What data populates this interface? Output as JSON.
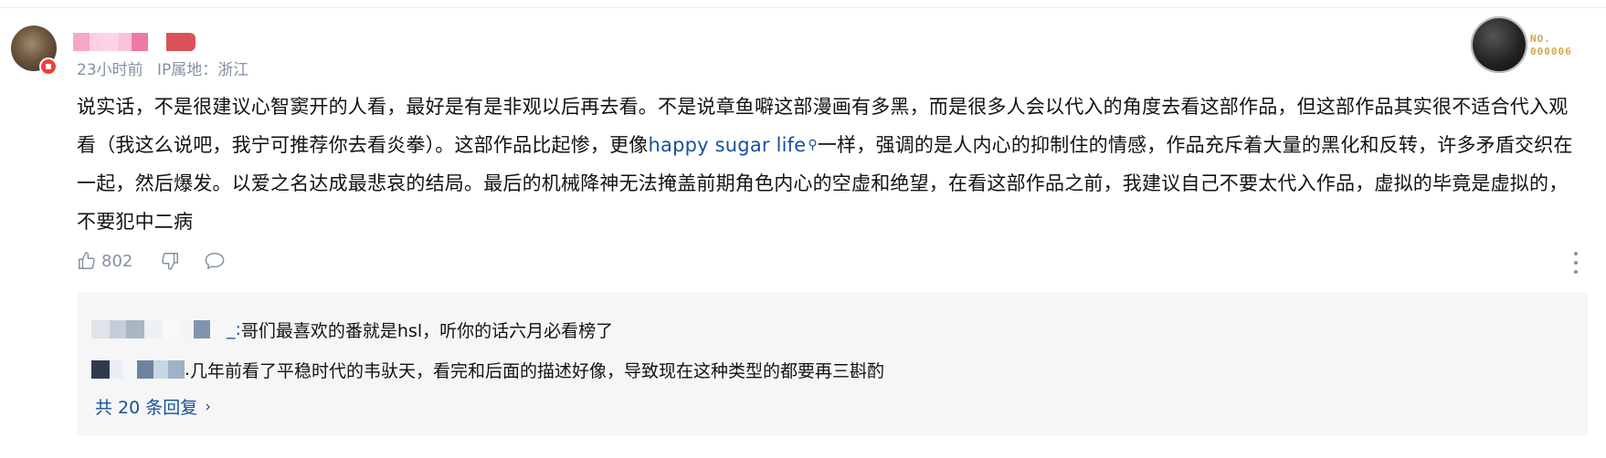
{
  "comment": {
    "meta": {
      "time": "23小时前",
      "ip_location": "IP属地：浙江"
    },
    "medal": {
      "label_line1": "NO.",
      "label_line2": "000006"
    },
    "content": {
      "text_before_link": "说实话，不是很建议心智窦开的人看，最好是有是非观以后再去看。不是说章鱼噼这部漫画有多黑，而是很多人会以代入的角度去看这部作品，但这部作品其实很不适合代入观看（我这么说吧，我宁可推荐你去看炎拳）。这部作品比起惨，更像",
      "link_text": "happy sugar life",
      "text_after_link": "一样，强调的是人内心的抑制住的情感，作品充斥着大量的黑化和反转，许多矛盾交织在一起，然后爆发。以爱之名达成最悲哀的结局。最后的机械降神无法掩盖前期角色内心的空虚和绝望，在看这部作品之前，我建议自己不要太代入作品，虚拟的毕竟是虚拟的，不要犯中二病"
    },
    "actions": {
      "like_count": "802"
    }
  },
  "replies": {
    "items": [
      {
        "name_suffix": "_: ",
        "text": "哥们最喜欢的番就是hsl，听你的话六月必看榜了"
      },
      {
        "name_suffix": ". ",
        "text": "几年前看了平稳时代的韦驮天，看完和后面的描述好像，导致现在这种类型的都要再三斟酌"
      }
    ],
    "more_label": "共 20 条回复"
  },
  "colors": {
    "link": "#175199",
    "meta_gray": "#8590a6",
    "reply_bg": "#f6f6f6"
  }
}
